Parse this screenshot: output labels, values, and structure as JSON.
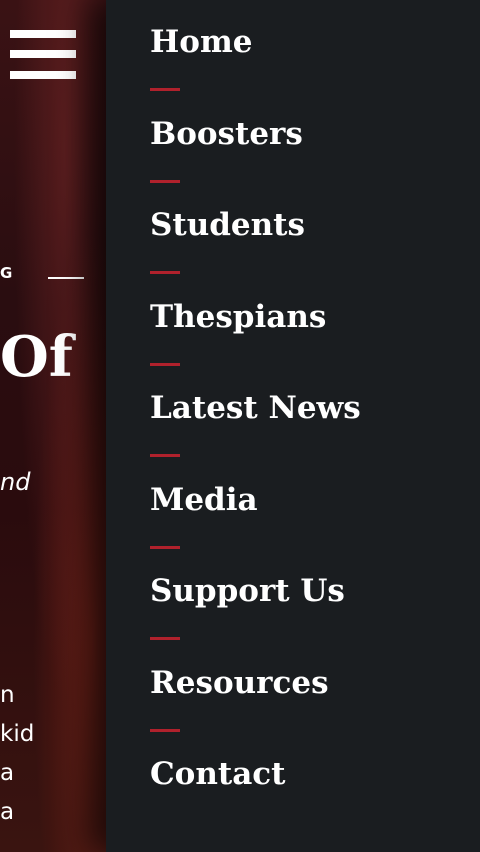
{
  "background_page": {
    "eyebrow": "G",
    "hero_title": "Of",
    "hero_italic": "nd",
    "body_lines": [
      "n",
      "kid",
      "a",
      "a"
    ]
  },
  "menu": {
    "icon": "hamburger-menu-icon",
    "items": [
      {
        "label": "Home"
      },
      {
        "label": "Boosters"
      },
      {
        "label": "Students"
      },
      {
        "label": "Thespians"
      },
      {
        "label": "Latest News"
      },
      {
        "label": "Media"
      },
      {
        "label": "Support Us"
      },
      {
        "label": "Resources"
      },
      {
        "label": "Contact"
      }
    ]
  },
  "colors": {
    "drawer_bg": "#1a1d20",
    "separator": "#b0212c",
    "text": "#ffffff"
  }
}
